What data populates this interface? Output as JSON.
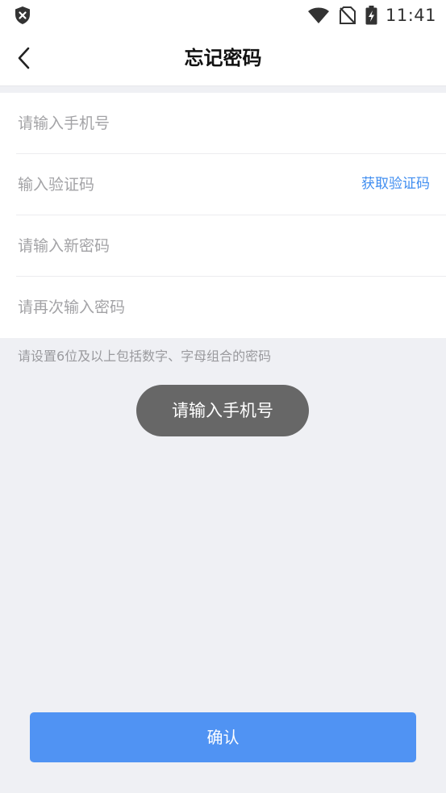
{
  "status_bar": {
    "time": "11:41",
    "icons": [
      "shield-x-icon",
      "wifi-icon",
      "no-sim-icon",
      "battery-charging-icon"
    ]
  },
  "nav": {
    "title": "忘记密码",
    "back_icon": "chevron-left-icon"
  },
  "form": {
    "phone_placeholder": "请输入手机号",
    "code_placeholder": "输入验证码",
    "get_code_label": "获取验证码",
    "new_password_placeholder": "请输入新密码",
    "confirm_password_placeholder": "请再次输入密码"
  },
  "hint": "请设置6位及以上包括数字、字母组合的密码",
  "toast": "请输入手机号",
  "confirm_label": "确认",
  "colors": {
    "accent": "#5093f3",
    "link": "#3f8df0",
    "background": "#eff0f4",
    "toast_bg": "#676767"
  }
}
